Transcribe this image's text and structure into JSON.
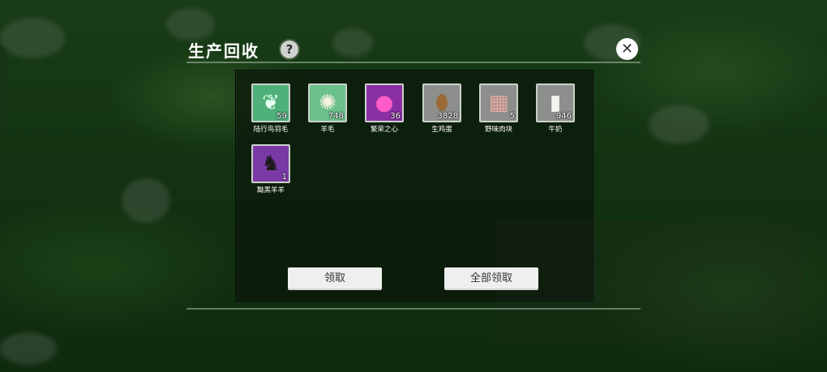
{
  "header": {
    "title": "生产回收",
    "help_glyph": "?",
    "close_glyph": "✕"
  },
  "items": [
    {
      "name": "陆行鸟羽毛",
      "count": "59",
      "icon": "feather-icon",
      "color": "#4fb07a"
    },
    {
      "name": "羊毛",
      "count": "748",
      "icon": "wool-icon",
      "color": "#6cc08a"
    },
    {
      "name": "繁荣之心",
      "count": "36",
      "icon": "gem-icon",
      "color": "#8a2fa3"
    },
    {
      "name": "生鸡蛋",
      "count": "3828",
      "icon": "egg-icon",
      "color": "#8d8f8d"
    },
    {
      "name": "野味肉块",
      "count": "5",
      "icon": "meat-icon",
      "color": "#8d8f8d"
    },
    {
      "name": "牛奶",
      "count": "946",
      "icon": "milk-icon",
      "color": "#8d8f8d"
    },
    {
      "name": "黝黑羊羊",
      "count": "1",
      "icon": "black-sheep-icon",
      "color": "#7a3aa6"
    }
  ],
  "buttons": {
    "claim": "领取",
    "claim_all": "全部领取"
  }
}
